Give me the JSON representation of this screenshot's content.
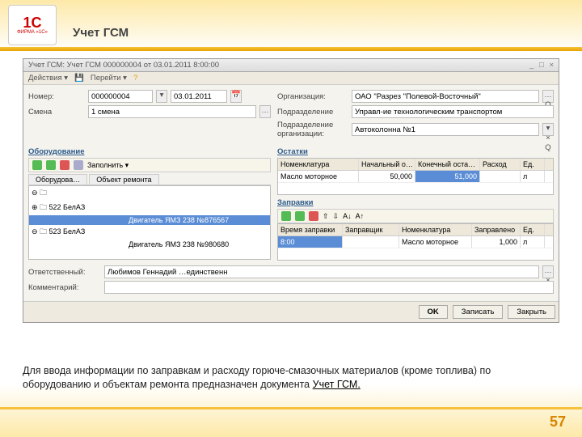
{
  "brand": {
    "top": "1С",
    "reg": "®",
    "bottom": "ФИРМА «1С»"
  },
  "page_title": "Учет ГСМ",
  "window_title": "Учет ГСМ: Учет ГСМ 000000004 от 03.01.2011 8:00:00",
  "toolbar": {
    "actions": "Действия ▾",
    "go": "Перейти ▾"
  },
  "fields": {
    "number_lbl": "Номер:",
    "number": "000000004",
    "date": "03.01.2011",
    "org_lbl": "Организация:",
    "org": "ОАО \"Разрез \"Полевой-Восточный\"",
    "shift_lbl": "Смена",
    "shift": "1 смена",
    "dept_lbl": "Подразделение",
    "dept": "Управл-ие технологическим транспортом",
    "dept2_lbl": "Подразделение\nорганизации:",
    "dept2": "Автоколонна №1"
  },
  "equip_hdr": "Оборудование",
  "equip_fill": "Заполнить ▾",
  "equip_tabs": {
    "a": "Оборудова…",
    "b": "Объект ремонта"
  },
  "equip_tree": [
    {
      "c1": "⊖ 🗀",
      "c2": ""
    },
    {
      "c1": "  ⊕ 🗀 522 БелАЗ",
      "c2": ""
    },
    {
      "c1": "",
      "c2": "Двигатель ЯМЗ 238 №876567"
    },
    {
      "c1": "  ⊖ 🗀 523 БелАЗ",
      "c2": ""
    },
    {
      "c1": "",
      "c2": "Двигатель ЯМЗ 238 №980680"
    }
  ],
  "remains_hdr": "Остатки",
  "remains_cols": {
    "nom": "Номенклатура",
    "beg": "Начальный о…",
    "end": "Конечный оста…",
    "exp": "Расход",
    "unit": "Ед."
  },
  "remains_row": {
    "nom": "Масло моторное",
    "beg": "50,000",
    "end": "51,000",
    "exp": "",
    "unit": "л"
  },
  "fill_hdr": "Заправки",
  "fill_cols": {
    "time": "Время заправки",
    "who": "Заправщик",
    "nom": "Номенклатура",
    "qty": "Заправлено",
    "unit": "Ед."
  },
  "fill_row": {
    "time": "8:00",
    "who": "",
    "nom": "Масло моторное",
    "qty": "1,000",
    "unit": "л"
  },
  "resp_lbl": "Ответственный:",
  "resp": "Любимов Геннадий …единственн",
  "comment_lbl": "Комментарий:",
  "buttons": {
    "ok": "OK",
    "save": "Записать",
    "close": "Закрыть"
  },
  "caption_a": "Для ввода информации по заправкам и расходу горюче-смазочных материалов (кроме топлива) по оборудованию и объектам ремонта предназначен документа ",
  "caption_b": "Учет ГСМ.",
  "page_num": "57",
  "chart_data": {
    "type": "table",
    "title": "Остатки",
    "columns": [
      "Номенклатура",
      "Начальный",
      "Конечный",
      "Расход",
      "Ед."
    ],
    "rows": [
      [
        "Масло моторное",
        50.0,
        51.0,
        null,
        "л"
      ]
    ]
  }
}
